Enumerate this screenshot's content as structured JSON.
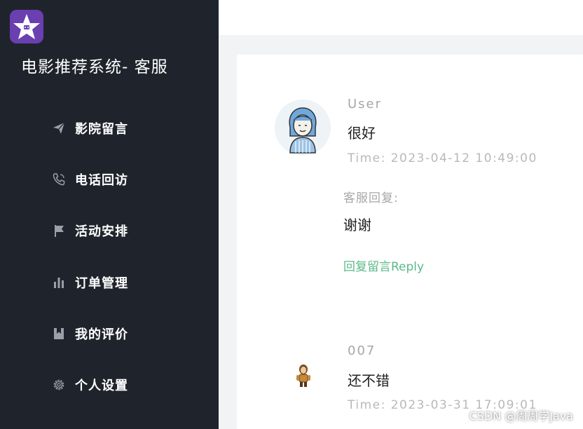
{
  "sidebar": {
    "app_title": "电影推荐系统- 客服",
    "items": [
      {
        "label": "影院留言",
        "icon": "paper-plane-icon"
      },
      {
        "label": "电话回访",
        "icon": "phone-icon"
      },
      {
        "label": "活动安排",
        "icon": "flag-icon"
      },
      {
        "label": "订单管理",
        "icon": "bar-chart-icon"
      },
      {
        "label": "我的评价",
        "icon": "bookmark-icon"
      },
      {
        "label": "个人设置",
        "icon": "gear-icon"
      }
    ]
  },
  "messages": [
    {
      "user": "User",
      "text": "很好",
      "time": "Time: 2023-04-12 10:49:00",
      "reply_label": "客服回复:",
      "reply_text": "谢谢",
      "reply_action": "回复留言Reply"
    },
    {
      "user": "007",
      "text": "还不错",
      "time": "Time: 2023-03-31 17:09:01"
    }
  ],
  "watermark": "CSDN @周周学Java",
  "colors": {
    "sidebar_bg": "#1f242c",
    "logo_bg": "#6a3fb0",
    "reply_link": "#5cb98a"
  }
}
